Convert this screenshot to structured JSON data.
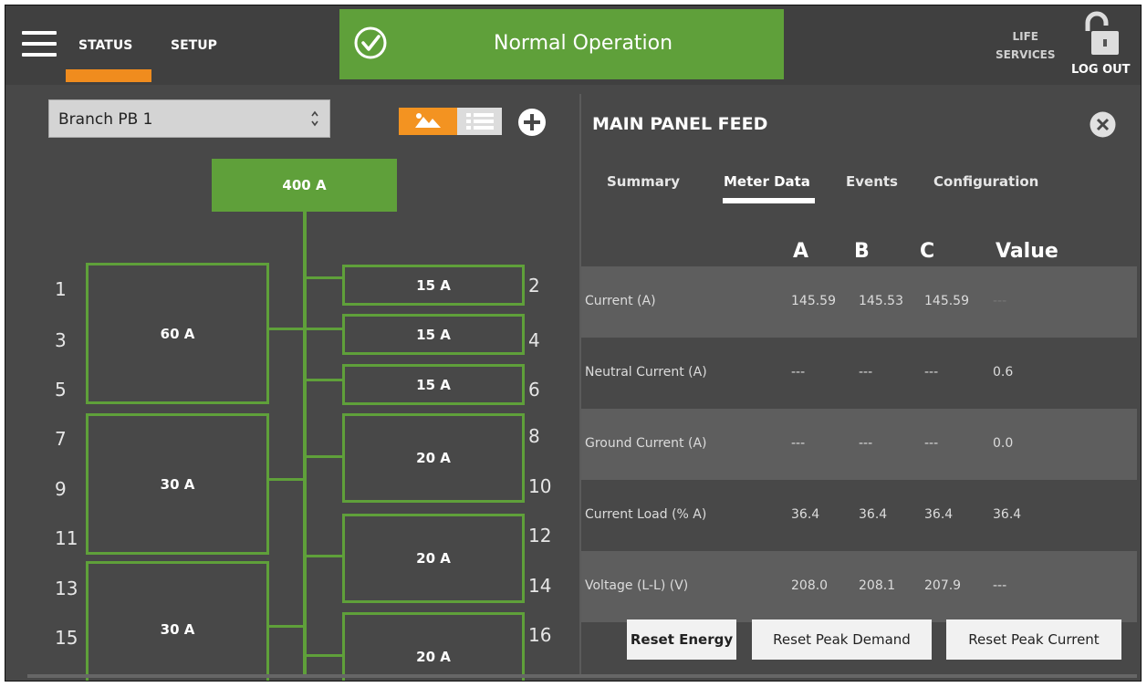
{
  "nav": {
    "status_label": "STATUS",
    "setup_label": "SETUP"
  },
  "status_banner": {
    "text": "Normal Operation",
    "color": "#5fa03a"
  },
  "header_right": {
    "life_services_line1": "LIFE",
    "life_services_line2": "SERVICES",
    "logout_label": "LOG OUT"
  },
  "left_panel": {
    "branch_select_value": "Branch PB 1",
    "main_breaker": "400 A",
    "slot_numbers_left": [
      "1",
      "3",
      "5",
      "7",
      "9",
      "11",
      "13",
      "15"
    ],
    "slot_numbers_right": [
      "2",
      "4",
      "6",
      "8",
      "10",
      "12",
      "14",
      "16"
    ],
    "breakers_left": [
      "60 A",
      "30 A",
      "30 A"
    ],
    "breakers_right": [
      "15 A",
      "15 A",
      "15 A",
      "20 A",
      "20 A",
      "20 A"
    ]
  },
  "right_panel": {
    "title": "MAIN PANEL FEED",
    "tabs": [
      "Summary",
      "Meter Data",
      "Events",
      "Configuration"
    ],
    "active_tab": "Meter Data",
    "columns": [
      "A",
      "B",
      "C",
      "Value"
    ],
    "rows": [
      {
        "label": "Current (A)",
        "a": "145.59",
        "b": "145.53",
        "c": "145.59",
        "value": "---"
      },
      {
        "label": "Neutral Current (A)",
        "a": "---",
        "b": "---",
        "c": "---",
        "value": "0.6"
      },
      {
        "label": "Ground Current (A)",
        "a": "---",
        "b": "---",
        "c": "---",
        "value": "0.0"
      },
      {
        "label": "Current Load (% A)",
        "a": "36.4",
        "b": "36.4",
        "c": "36.4",
        "value": "36.4"
      },
      {
        "label": "Voltage (L-L) (V)",
        "a": "208.0",
        "b": "208.1",
        "c": "207.9",
        "value": "---"
      }
    ],
    "buttons": {
      "reset_energy": "Reset Energy",
      "reset_peak_demand": "Reset Peak Demand",
      "reset_peak_current": "Reset Peak Current"
    }
  },
  "colors": {
    "accent_orange": "#f08c1e",
    "breaker_green": "#5fa03a",
    "background": "#484848"
  }
}
